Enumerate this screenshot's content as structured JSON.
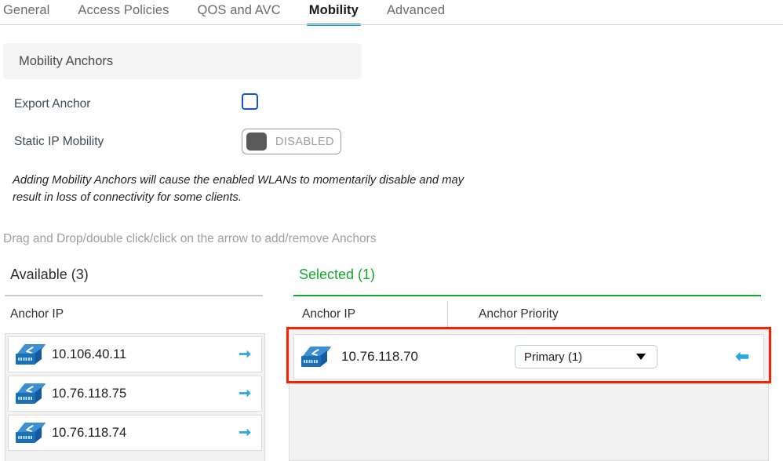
{
  "tabs": [
    {
      "label": "General",
      "active": false
    },
    {
      "label": "Access Policies",
      "active": false
    },
    {
      "label": "QOS and AVC",
      "active": false
    },
    {
      "label": "Mobility",
      "active": true
    },
    {
      "label": "Advanced",
      "active": false
    }
  ],
  "panel": {
    "title": "Mobility Anchors"
  },
  "form": {
    "export_anchor_label": "Export Anchor",
    "export_anchor_checked": false,
    "static_ip_label": "Static IP Mobility",
    "static_ip_state": "DISABLED"
  },
  "note": "Adding Mobility Anchors will cause the enabled WLANs to momentarily disable and may result in loss of connectivity for some clients.",
  "drag_hint": "Drag and Drop/double click/click on the arrow to add/remove Anchors",
  "available": {
    "title": "Available (3)",
    "column_header": "Anchor IP",
    "items": [
      {
        "ip": "10.106.40.11"
      },
      {
        "ip": "10.76.118.75"
      },
      {
        "ip": "10.76.118.74"
      }
    ]
  },
  "selected": {
    "title": "Selected (1)",
    "column_header_ip": "Anchor IP",
    "column_header_priority": "Anchor Priority",
    "items": [
      {
        "ip": "10.76.118.70",
        "priority": "Primary (1)"
      }
    ]
  },
  "colors": {
    "active_tab_underline": "#1b9bd8",
    "selected_green": "#16a72f",
    "arrow_blue": "#29a8e0",
    "checkbox_blue": "#1453d8",
    "highlight_red": "#fb2100"
  }
}
